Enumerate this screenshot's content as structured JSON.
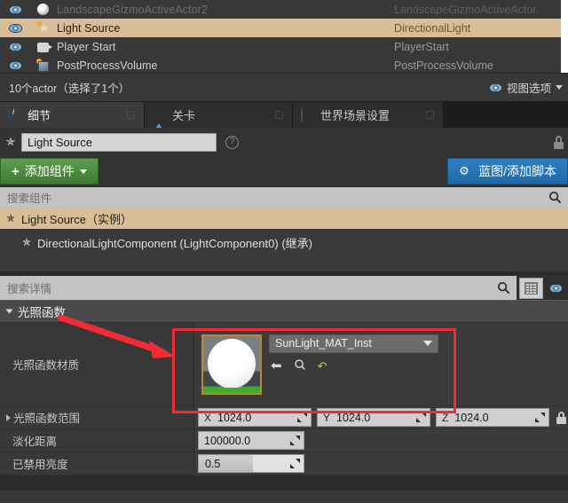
{
  "outliner": {
    "rows": [
      {
        "label": "LandscapeGizmoActiveActor2",
        "type": "LandscapeGizmoActiveActor",
        "icon": "sphere-icon",
        "state": "dim"
      },
      {
        "label": "Light Source",
        "type": "DirectionalLight",
        "icon": "light-icon",
        "state": "selected"
      },
      {
        "label": "Player Start",
        "type": "PlayerStart",
        "icon": "player-start-icon",
        "state": "normal"
      },
      {
        "label": "PostProcessVolume",
        "type": "PostProcessVolume",
        "icon": "volume-icon",
        "state": "normal"
      }
    ],
    "footer": {
      "count_text": "10个actor（选择了1个）",
      "view_options_label": "视图选项",
      "view_options_icon": "eye-icon"
    },
    "visibility_icon": "eye-icon"
  },
  "tabs": [
    {
      "label": "细节",
      "icon": "info-icon",
      "active": true
    },
    {
      "label": "关卡",
      "icon": "level-icon",
      "active": false
    },
    {
      "label": "世界场景设置",
      "icon": "world-icon",
      "active": false
    }
  ],
  "name_row": {
    "actor_icon": "light-icon",
    "value": "Light Source",
    "placeholder": "Light Source",
    "help_icon": "help-icon",
    "lock_icon": "lock-icon"
  },
  "toolbar": {
    "add_component_label": "添加组件",
    "add_component_icon": "plus-icon",
    "add_component_caret": "chevron-down-icon",
    "blueprint_label": "蓝图/添加脚本",
    "blueprint_icon": "gear-icon"
  },
  "component_search": {
    "placeholder": "搜索组件",
    "icon": "search-icon"
  },
  "component_tree": [
    {
      "label": "Light Source（实例）",
      "icon": "light-icon",
      "selected": true,
      "depth": 0
    },
    {
      "label": "DirectionalLightComponent (LightComponent0) (继承)",
      "icon": "light-icon",
      "selected": false,
      "depth": 1
    }
  ],
  "details_search": {
    "placeholder": "搜索详情",
    "icon": "search-icon",
    "columns_button_icon": "grid-icon",
    "visibility_button_icon": "eye-icon"
  },
  "section": {
    "title": "光照函数",
    "expander_icon": "chevron-down-icon"
  },
  "properties": {
    "material": {
      "label": "光照函数材质",
      "value": "SunLight_MAT_Inst",
      "dropdown_icon": "chevron-down-icon",
      "thumbnail_name": "material-thumbnail",
      "actions": [
        {
          "icon": "use-selected-arrow-icon",
          "glyph": "⬅"
        },
        {
          "icon": "browse-search-icon",
          "glyph": "⌕"
        },
        {
          "icon": "reset-arrow-icon",
          "glyph": "↶"
        }
      ]
    },
    "scale": {
      "label": "光照函数范围",
      "expander_icon": "chevron-right-icon",
      "axes": [
        {
          "axis": "X",
          "value": "1024.0"
        },
        {
          "axis": "Y",
          "value": "1024.0"
        },
        {
          "axis": "Z",
          "value": "1024.0"
        }
      ],
      "lock_icon": "lock-icon"
    },
    "fade_distance": {
      "label": "淡化距离",
      "value": "100000.0"
    },
    "disabled_brightness": {
      "label": "已禁用亮度",
      "value": "0.5"
    }
  },
  "annotation": {
    "highlight_color": "#ef2b34",
    "arrow_color": "#ef2b34"
  }
}
